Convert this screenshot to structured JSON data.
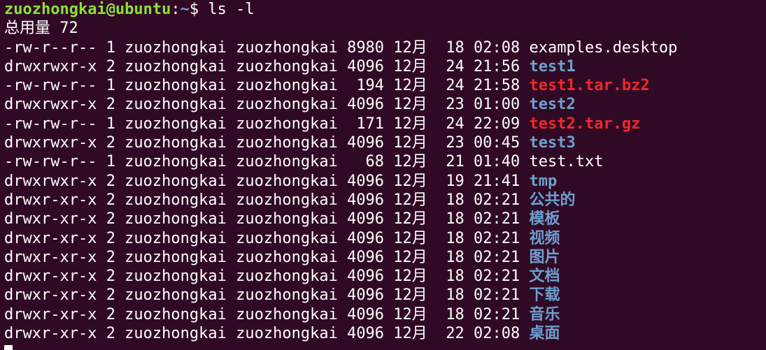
{
  "colors": {
    "background": "#300a24",
    "user_host": "#8ae234",
    "path": "#729fcf",
    "directory": "#6d9fcf",
    "archive": "#ef2929",
    "text": "#ffffff"
  },
  "prompt": {
    "user_host": "zuozhongkai@ubuntu",
    "separator": ":",
    "path": "~",
    "symbol": "$ ",
    "command": "ls -l"
  },
  "total_line": "总用量 72",
  "rows": [
    {
      "meta": "-rw-r--r-- 1 zuozhongkai zuozhongkai 8980 12月  18 02:08 ",
      "name": "examples.desktop",
      "kind": "file"
    },
    {
      "meta": "drwxrwxr-x 2 zuozhongkai zuozhongkai 4096 12月  24 21:56 ",
      "name": "test1",
      "kind": "dir"
    },
    {
      "meta": "-rw-rw-r-- 1 zuozhongkai zuozhongkai  194 12月  24 21:58 ",
      "name": "test1.tar.bz2",
      "kind": "archive"
    },
    {
      "meta": "drwxrwxr-x 2 zuozhongkai zuozhongkai 4096 12月  23 01:00 ",
      "name": "test2",
      "kind": "dir"
    },
    {
      "meta": "-rw-rw-r-- 1 zuozhongkai zuozhongkai  171 12月  24 22:09 ",
      "name": "test2.tar.gz",
      "kind": "archive"
    },
    {
      "meta": "drwxrwxr-x 2 zuozhongkai zuozhongkai 4096 12月  23 00:45 ",
      "name": "test3",
      "kind": "dir"
    },
    {
      "meta": "-rw-rw-r-- 1 zuozhongkai zuozhongkai   68 12月  21 01:40 ",
      "name": "test.txt",
      "kind": "file"
    },
    {
      "meta": "drwxrwxr-x 2 zuozhongkai zuozhongkai 4096 12月  19 21:41 ",
      "name": "tmp",
      "kind": "dir"
    },
    {
      "meta": "drwxr-xr-x 2 zuozhongkai zuozhongkai 4096 12月  18 02:21 ",
      "name": "公共的",
      "kind": "dir"
    },
    {
      "meta": "drwxr-xr-x 2 zuozhongkai zuozhongkai 4096 12月  18 02:21 ",
      "name": "模板",
      "kind": "dir"
    },
    {
      "meta": "drwxr-xr-x 2 zuozhongkai zuozhongkai 4096 12月  18 02:21 ",
      "name": "视频",
      "kind": "dir"
    },
    {
      "meta": "drwxr-xr-x 2 zuozhongkai zuozhongkai 4096 12月  18 02:21 ",
      "name": "图片",
      "kind": "dir"
    },
    {
      "meta": "drwxr-xr-x 2 zuozhongkai zuozhongkai 4096 12月  18 02:21 ",
      "name": "文档",
      "kind": "dir"
    },
    {
      "meta": "drwxr-xr-x 2 zuozhongkai zuozhongkai 4096 12月  18 02:21 ",
      "name": "下载",
      "kind": "dir"
    },
    {
      "meta": "drwxr-xr-x 2 zuozhongkai zuozhongkai 4096 12月  18 02:21 ",
      "name": "音乐",
      "kind": "dir"
    },
    {
      "meta": "drwxr-xr-x 2 zuozhongkai zuozhongkai 4096 12月  22 02:08 ",
      "name": "桌面",
      "kind": "dir"
    }
  ]
}
